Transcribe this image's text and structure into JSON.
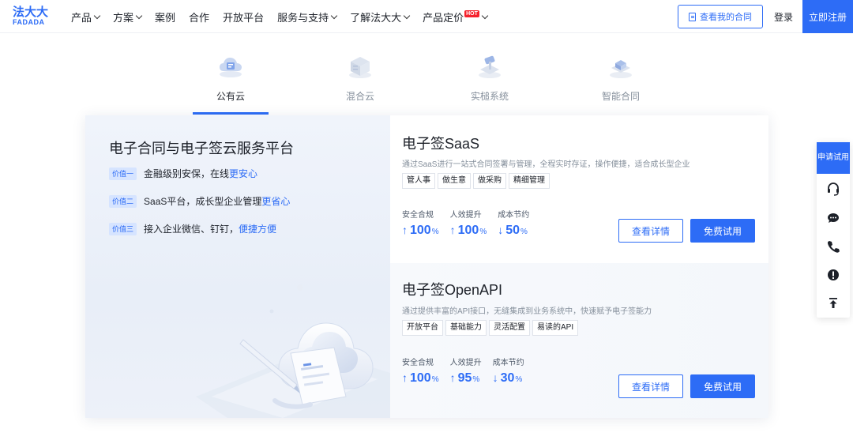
{
  "logo": {
    "cn": "法大大",
    "en": "FADADA"
  },
  "nav": [
    {
      "label": "产品",
      "dropdown": true
    },
    {
      "label": "方案",
      "dropdown": true
    },
    {
      "label": "案例",
      "dropdown": false
    },
    {
      "label": "合作",
      "dropdown": false
    },
    {
      "label": "开放平台",
      "dropdown": false
    },
    {
      "label": "服务与支持",
      "dropdown": true
    },
    {
      "label": "了解法大大",
      "dropdown": true
    },
    {
      "label": "产品定价",
      "dropdown": true,
      "badge": "HOT"
    }
  ],
  "header": {
    "contract_label": "查看我的合同",
    "login": "登录",
    "register": "立即注册"
  },
  "tabs": [
    {
      "label": "公有云",
      "icon": "public-cloud-icon",
      "active": true
    },
    {
      "label": "混合云",
      "icon": "hybrid-cloud-icon",
      "active": false
    },
    {
      "label": "实槌系统",
      "icon": "hammer-system-icon",
      "active": false
    },
    {
      "label": "智能合同",
      "icon": "smart-contract-icon",
      "active": false
    }
  ],
  "left": {
    "title": "电子合同与电子签云服务平台",
    "values": [
      {
        "tag": "价值一",
        "text": "金融级别安保，在线",
        "highlight": "更安心"
      },
      {
        "tag": "价值二",
        "text": "SaaS平台，成长型企业管理",
        "highlight": "更省心"
      },
      {
        "tag": "价值三",
        "text": "接入企业微信、钉钉，",
        "highlight": "便捷方便"
      }
    ]
  },
  "products": [
    {
      "title": "电子签SaaS",
      "desc": "通过SaaS进行一站式合同签署与管理，全程实时存证，操作便捷，适合成长型企业",
      "tags": [
        "管人事",
        "做生意",
        "做采购",
        "精细管理"
      ],
      "metrics": [
        {
          "label": "安全合规",
          "arrow": "↑",
          "value": "100",
          "unit": "%"
        },
        {
          "label": "人效提升",
          "arrow": "↑",
          "value": "100",
          "unit": "%"
        },
        {
          "label": "成本节约",
          "arrow": "↓",
          "value": "50",
          "unit": "%"
        }
      ],
      "detail_label": "查看详情",
      "try_label": "免费试用"
    },
    {
      "title": "电子签OpenAPI",
      "desc": "通过提供丰富的API接口，无缝集成到业务系统中，快速赋予电子签能力",
      "tags": [
        "开放平台",
        "基础能力",
        "灵活配置",
        "易读的API"
      ],
      "metrics": [
        {
          "label": "安全合规",
          "arrow": "↑",
          "value": "100",
          "unit": "%"
        },
        {
          "label": "人效提升",
          "arrow": "↑",
          "value": "95",
          "unit": "%"
        },
        {
          "label": "成本节约",
          "arrow": "↓",
          "value": "30",
          "unit": "%"
        }
      ],
      "detail_label": "查看详情",
      "try_label": "免费试用"
    }
  ],
  "float": {
    "apply": "申请试用",
    "icons": [
      "headset-icon",
      "chat-icon",
      "phone-icon",
      "alert-icon",
      "back-to-top-icon"
    ]
  },
  "colors": {
    "accent": "#2d6cf6",
    "text": "#1d2129",
    "muted": "#86909c"
  }
}
